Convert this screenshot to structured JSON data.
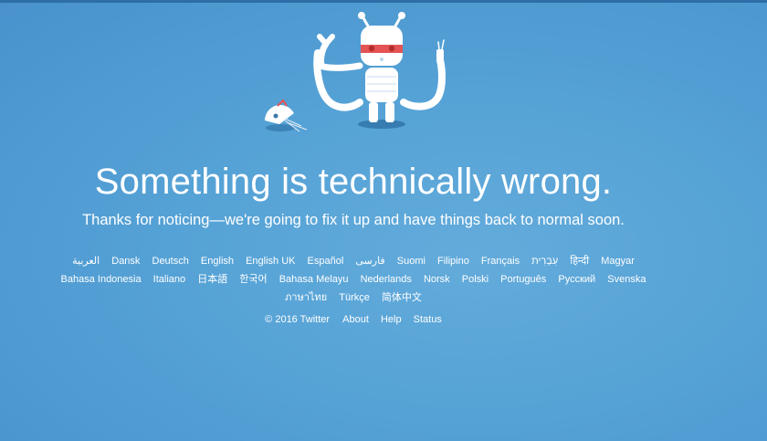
{
  "page": {
    "headline": "Something is technically wrong.",
    "subtext": "Thanks for noticing—we're going to fix it up and have things back to normal soon."
  },
  "languages": {
    "row1": [
      "العربية",
      "Dansk",
      "Deutsch",
      "English",
      "English UK",
      "Español",
      "فارسی",
      "Suomi",
      "Filipino",
      "Français",
      "עִבְרִית",
      "हिन्दी",
      "Magyar"
    ],
    "row2": [
      "Bahasa Indonesia",
      "Italiano",
      "日本語",
      "한국어",
      "Bahasa Melayu",
      "Nederlands",
      "Norsk",
      "Polski",
      "Português",
      "Русский",
      "Svenska"
    ],
    "row3": [
      "ภาษาไทย",
      "Türkçe",
      "简体中文"
    ]
  },
  "footer": {
    "copyright": "© 2016 Twitter",
    "about": "About",
    "help": "Help",
    "status": "Status"
  },
  "colors": {
    "background": "#55a2d6",
    "text": "#ffffff",
    "robot_mask": "#e45454"
  },
  "icons": {
    "illustration": "broken-robot-illustration"
  }
}
